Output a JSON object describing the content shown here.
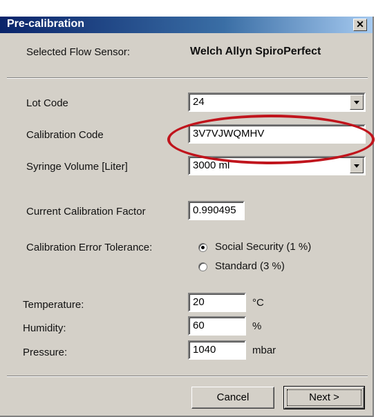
{
  "window": {
    "title": "Pre-calibration",
    "close_label": "✕"
  },
  "sensor": {
    "label": "Selected Flow Sensor:",
    "value": "Welch Allyn SpiroPerfect"
  },
  "lot_code": {
    "label": "Lot Code",
    "value": "24"
  },
  "calibration_code": {
    "label": "Calibration Code",
    "value": "3V7VJWQMHV"
  },
  "syringe": {
    "label": "Syringe Volume [Liter]",
    "value": "3000 ml"
  },
  "current_factor": {
    "label": "Current Calibration Factor",
    "value": "0.990495"
  },
  "tolerance": {
    "label": "Calibration Error Tolerance:",
    "options": [
      {
        "label": "Social Security (1 %)",
        "selected": true
      },
      {
        "label": "Standard (3 %)",
        "selected": false
      }
    ]
  },
  "temperature": {
    "label": "Temperature:",
    "value": "20",
    "unit": "°C"
  },
  "humidity": {
    "label": "Humidity:",
    "value": "60",
    "unit": "%"
  },
  "pressure": {
    "label": "Pressure:",
    "value": "1040",
    "unit": "mbar"
  },
  "buttons": {
    "cancel": "Cancel",
    "next": "Next >"
  },
  "colors": {
    "titlebar": "#0a246a",
    "dialog_bg": "#d4d0c8",
    "highlight_ellipse": "#c0141c"
  }
}
